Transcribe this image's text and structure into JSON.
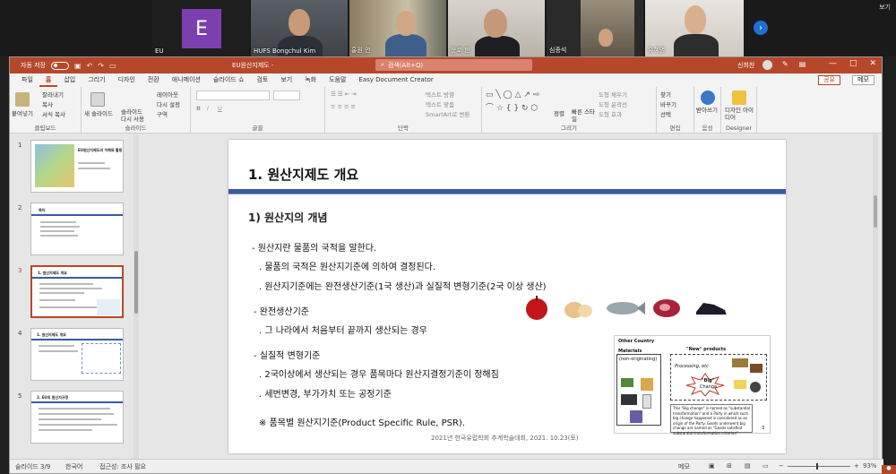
{
  "video_strip": {
    "tiles": [
      {
        "name": "EU",
        "avatar_letter": "E"
      },
      {
        "name": "HUFS Bongchul Kim"
      },
      {
        "name": "홍원 안"
      },
      {
        "name": "운호 한"
      },
      {
        "name": "심종석"
      },
      {
        "name": "유혜영"
      }
    ],
    "top_right_label": "보기",
    "next_icon": "chevron-right-icon"
  },
  "titlebar": {
    "autosave_label": "자동 저장",
    "toggle_state": "끔",
    "doc_title": "EU원산지제도 -",
    "search_placeholder": "검색(Alt+Q)",
    "user_name": "신희찬",
    "win_min": "—",
    "win_max": "□",
    "win_close": "✕"
  },
  "menu": {
    "tabs": [
      "파일",
      "홈",
      "삽입",
      "그리기",
      "디자인",
      "전환",
      "애니메이션",
      "슬라이드 쇼",
      "검토",
      "보기",
      "녹화",
      "도움말",
      "Easy Document Creator"
    ],
    "active": "홈",
    "share_label": "공유",
    "memo_label": "메모"
  },
  "ribbon": {
    "clipboard": {
      "paste": "붙여넣기",
      "cut": "잘라내기",
      "copy": "복사",
      "format_painter": "서식 복사",
      "label": "클립보드"
    },
    "slides": {
      "new_slide": "새 슬라이드",
      "reuse": "슬라이드 다시 사용",
      "layout": "레이아웃",
      "reset": "다시 설정",
      "section": "구역",
      "label": "슬라이드"
    },
    "font": {
      "label": "글꼴"
    },
    "paragraph": {
      "text_direction": "텍스트 방향",
      "align_text": "텍스트 맞춤",
      "smartart": "SmartArt로 변환",
      "label": "단락"
    },
    "drawing": {
      "arrange": "정렬",
      "quick_styles": "빠른 스타일",
      "shape_fill": "도형 채우기",
      "shape_outline": "도형 윤곽선",
      "shape_effects": "도형 효과",
      "label": "그리기"
    },
    "editing": {
      "find": "찾기",
      "replace": "바꾸기",
      "select": "선택",
      "label": "편집"
    },
    "voice": {
      "dictate": "받아쓰기",
      "label": "음성"
    },
    "designer": {
      "ideas": "디자인 아이디어",
      "label": "Designer"
    }
  },
  "thumbnails": {
    "items": [
      {
        "num": "1",
        "title": "EU원산지제도의 이해와 활용"
      },
      {
        "num": "2",
        "title": "목차"
      },
      {
        "num": "3",
        "title": "1. 원산지제도 개요"
      },
      {
        "num": "4",
        "title": "1. 원산지제도 개요"
      },
      {
        "num": "5",
        "title": "2. EU의 원산지규정"
      }
    ],
    "selected": "3"
  },
  "slide": {
    "title": "1. 원산지제도 개요",
    "subheading": "1)  원산지의 개념",
    "lines": [
      "- 원산지란 물품의 국적을 말한다.",
      ". 물품의 국적은 원산지기준에 의하여 결정된다.",
      ". 원산지기준에는 완전생산기준(1국 생산)과 실질적 변형기준(2국 이상 생산)",
      "- 완전생산기준",
      ". 그 나라에서 처음부터 끝까지 생산되는 경우",
      "- 실질적 변형기준",
      ". 2국이상에서 생산되는 경우 품목마다 원산지결정기준이 정해짐",
      ". 세번변경, 부가가치 또는 공정기준",
      "※ 품목별 원산지기준(Product Specific Rule, PSR)."
    ],
    "footer": "2021년 한국유럽학회 추계학술대회, 2021. 10.23(토)",
    "food_icons": [
      "apple-icon",
      "onion-icon",
      "fish-icon",
      "meat-icon",
      "shoe-icon"
    ],
    "diagram": {
      "other_country": "Other Country",
      "materials": "Materials",
      "non_originating": "(non-originating)",
      "new_products": "\"New\" products",
      "processing": "Processing, etc",
      "big": "\"Big\"",
      "change": "Change",
      "note": "This \"Big change\" is named as \"substantial transformation\" and a Party in which such big change happened is considered as an origin of the Party. Goods underwent big change are named as \"Goods satisfied substantial transformation criterion\".",
      "page": "3"
    }
  },
  "statusbar": {
    "slide_info": "슬라이드 3/9",
    "language": "한국어",
    "accessibility": "접근성: 조사 필요",
    "notes": "메모",
    "zoom": "93%"
  },
  "colors": {
    "accent": "#b7472a",
    "title_rule": "#3a5aa3"
  }
}
